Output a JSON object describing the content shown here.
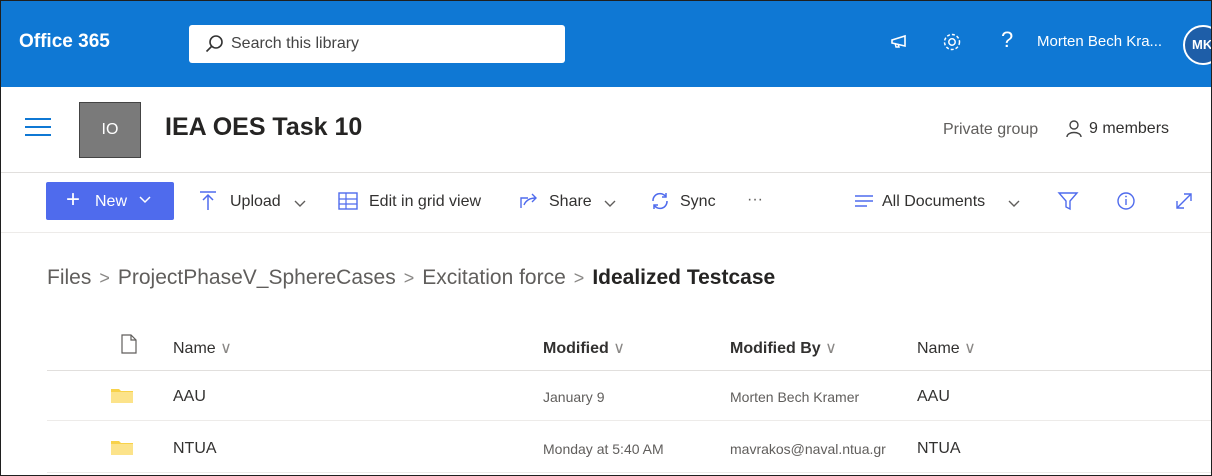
{
  "suite": {
    "brand": "Office 365",
    "search_placeholder": "Search this library",
    "user_name": "Morten Bech Kra...",
    "avatar_initials": "MK",
    "help_glyph": "?",
    "icons": [
      "megaphone-icon",
      "gear-icon",
      "help-icon"
    ]
  },
  "site": {
    "logo_text": "IO",
    "title": "IEA OES Task 10",
    "privacy": "Private group",
    "members": "9 members"
  },
  "commands": {
    "new": "New",
    "upload": "Upload",
    "edit_grid": "Edit in grid view",
    "share": "Share",
    "sync": "Sync",
    "more": "···",
    "view": "All Documents"
  },
  "breadcrumb": {
    "items": [
      "Files",
      "ProjectPhaseV_SphereCases",
      "Excitation force"
    ],
    "current": "Idealized Testcase",
    "separator": ">"
  },
  "list": {
    "columns": [
      "Name",
      "Modified",
      "Modified By",
      "Name"
    ],
    "rows": [
      {
        "name": "AAU",
        "modified": "January 9",
        "modified_by": "Morten Bech Kramer",
        "name2": "AAU"
      },
      {
        "name": "NTUA",
        "modified": "Monday at 5:40 AM",
        "modified_by": "mavrakos@naval.ntua.gr",
        "name2": "NTUA"
      }
    ]
  },
  "colors": {
    "suite_bar": "#0f78d4",
    "new_button": "#4f6bed",
    "folder": "#f8d24a"
  }
}
